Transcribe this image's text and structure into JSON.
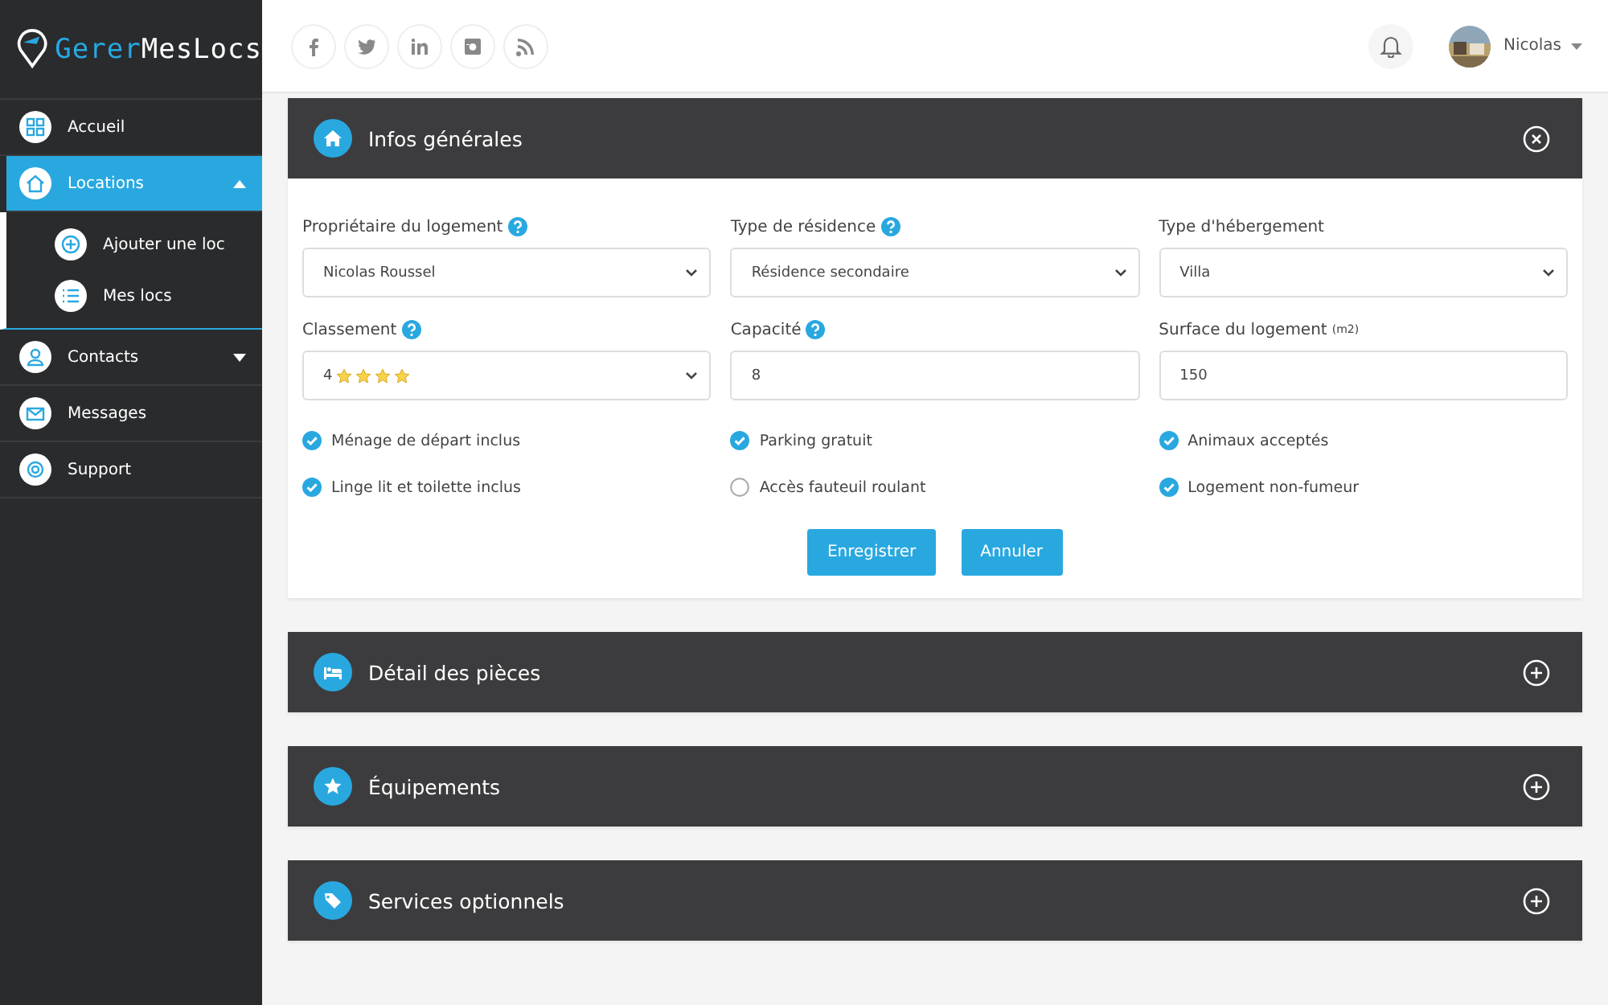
{
  "logo": {
    "part1": "Gerer",
    "part2": "MesLocs"
  },
  "sidebar": {
    "items": [
      {
        "label": "Accueil",
        "kind": "link",
        "selected": false
      },
      {
        "label": "Locations",
        "kind": "group",
        "selected": true,
        "expanded": true,
        "children": [
          {
            "label": "Ajouter une loc"
          },
          {
            "label": "Mes locs"
          }
        ]
      },
      {
        "label": "Contacts",
        "kind": "group",
        "selected": false,
        "expanded": false
      },
      {
        "label": "Messages",
        "kind": "link",
        "selected": false
      },
      {
        "label": "Support",
        "kind": "link",
        "selected": false
      }
    ]
  },
  "user": {
    "name": "Nicolas"
  },
  "sections": [
    {
      "title": "Infos générales",
      "expanded": true,
      "fields": [
        {
          "label": "Propriétaire du logement",
          "help": true,
          "kind": "select",
          "value": "Nicolas Roussel"
        },
        {
          "label": "Type de résidence",
          "help": true,
          "kind": "select",
          "value": "Résidence secondaire"
        },
        {
          "label": "Type d'hébergement",
          "help": false,
          "kind": "select",
          "value": "Villa"
        },
        {
          "label": "Classement",
          "help": true,
          "kind": "rating",
          "value": "4",
          "stars": 4
        },
        {
          "label": "Capacité",
          "help": true,
          "kind": "input",
          "value": "8"
        },
        {
          "label": "Surface du logement",
          "unit": "(m2)",
          "help": false,
          "kind": "input",
          "value": "150"
        }
      ],
      "options": [
        {
          "label": "Ménage de départ inclus",
          "checked": true
        },
        {
          "label": "Parking gratuit",
          "checked": true
        },
        {
          "label": "Animaux acceptés",
          "checked": true
        },
        {
          "label": "Linge lit et toilette inclus",
          "checked": true
        },
        {
          "label": "Accès fauteuil roulant",
          "checked": false
        },
        {
          "label": "Logement non-fumeur",
          "checked": true
        }
      ],
      "buttons": [
        "Enregistrer",
        "Annuler"
      ]
    },
    {
      "title": "Détail des pièces",
      "expanded": false
    },
    {
      "title": "Équipements",
      "expanded": false
    },
    {
      "title": "Services optionnels",
      "expanded": false
    }
  ]
}
